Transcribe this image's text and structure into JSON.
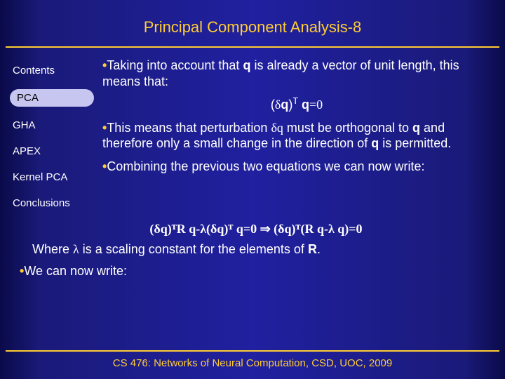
{
  "header": {
    "title": "Principal Component Analysis-8"
  },
  "sidebar": {
    "items": [
      {
        "label": "Contents",
        "active": false
      },
      {
        "label": "PCA",
        "active": true
      },
      {
        "label": "GHA",
        "active": false
      },
      {
        "label": "APEX",
        "active": false
      },
      {
        "label": "Kernel PCA",
        "active": false
      },
      {
        "label": "Conclusions",
        "active": false
      }
    ]
  },
  "main": {
    "bullet1_a": "Taking into account that ",
    "bullet1_b": " is already a vector of unit length, this means that:",
    "q": "q",
    "eq1_a": "(",
    "eq1_delta": "δ",
    "eq1_b": "q",
    "eq1_c": ")",
    "eq1_sup": "T",
    "eq1_d": " q",
    "eq1_e": "=0",
    "bullet2_a": "This means that perturbation ",
    "bullet2_dq": "δq",
    "bullet2_b": " must be orthogonal to ",
    "bullet2_c": " and therefore only a small change in the direction of ",
    "bullet2_d": " is permitted.",
    "bullet3": "Combining the previous two equations we can now write:",
    "eq2": "(δq)ᵀR q-λ(δq)ᵀ q=0 ⇒ (δq)ᵀ(R q-λ q)=0",
    "where_a": "Where ",
    "where_lambda": "λ",
    "where_b": " is a scaling constant for the elements of ",
    "where_R": "R",
    "where_c": ".",
    "bullet4": "We can now write:"
  },
  "footer": {
    "text": "CS 476: Networks of Neural Computation, CSD, UOC, 2009"
  }
}
